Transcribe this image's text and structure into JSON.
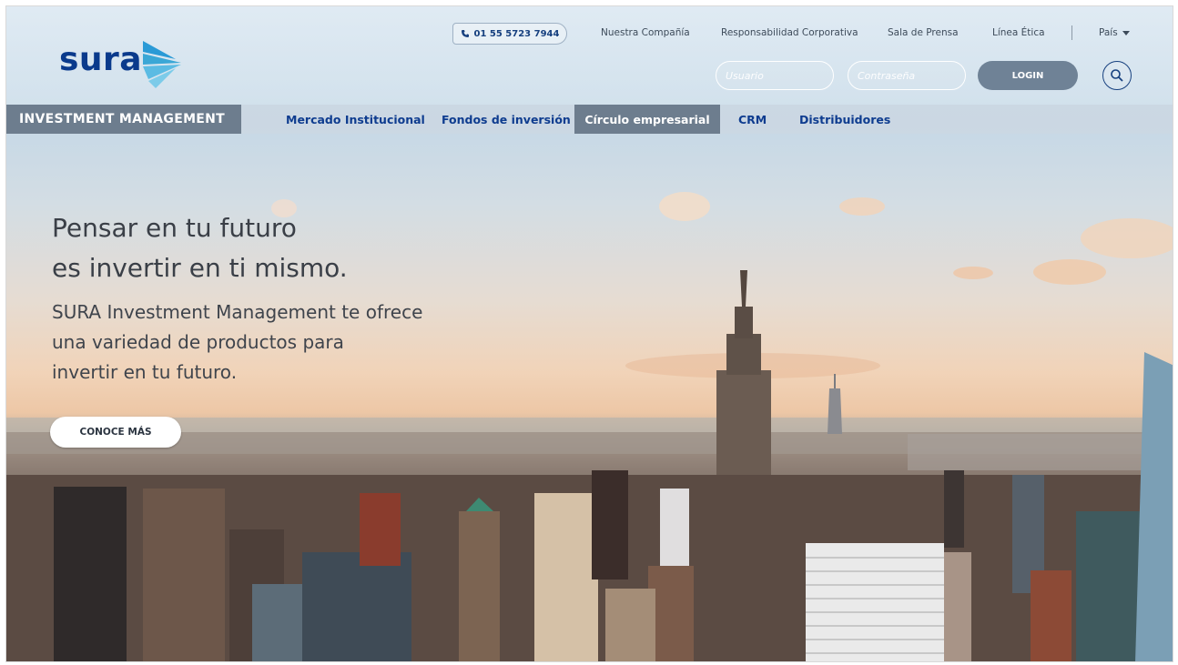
{
  "brand": {
    "logo_text": "sura",
    "section_label": "INVESTMENT MANAGEMENT"
  },
  "topbar": {
    "phone": "01 55 5723 7944",
    "links": [
      "Nuestra Compañía",
      "Responsabilidad Corporativa",
      "Sala de Prensa",
      "Línea Ética"
    ],
    "country_label": "País"
  },
  "login": {
    "user_placeholder": "Usuario",
    "password_placeholder": "Contraseña",
    "button_label": "LOGIN"
  },
  "nav": {
    "items": [
      "Mercado Institucional",
      "Fondos de inversión",
      "Círculo empresarial",
      "CRM",
      "Distribuidores"
    ],
    "active_index": 2
  },
  "hero": {
    "title_line1": "Pensar en tu futuro",
    "title_line2": "es invertir en ti mismo.",
    "subtitle_line1": "SURA Investment Management te ofrece",
    "subtitle_line2": "una variedad de productos para",
    "subtitle_line3": "invertir en tu futuro.",
    "cta_label": "CONOCE MÁS"
  },
  "colors": {
    "brand_blue": "#0a3a8c",
    "accent_cyan": "#3aa7d6",
    "nav_active_bg": "#6d7d8e",
    "login_bg": "#6f8296"
  },
  "icons": {
    "phone": "phone-icon",
    "search": "search-icon",
    "caret": "caret-down-icon",
    "logo_mark": "sura-chevron-icon"
  }
}
